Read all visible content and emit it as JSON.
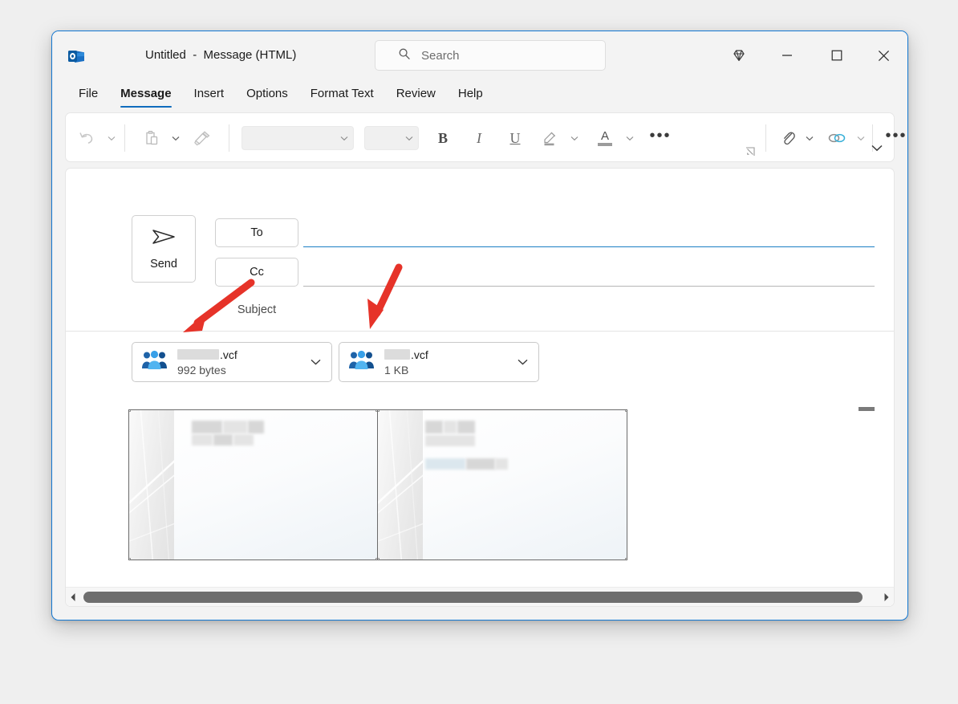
{
  "window": {
    "title": "Untitled  -  Message (HTML)",
    "app_icon": "outlook-icon",
    "border_color": "#1277d1"
  },
  "titlebar": {
    "search": {
      "placeholder": "Search",
      "icon": "search-icon"
    },
    "controls": [
      {
        "name": "diamond-icon",
        "label": ""
      },
      {
        "name": "minimize-icon",
        "label": ""
      },
      {
        "name": "maximize-icon",
        "label": ""
      },
      {
        "name": "close-icon",
        "label": ""
      }
    ]
  },
  "ribbon": {
    "tabs": [
      {
        "label": "File",
        "active": false
      },
      {
        "label": "Message",
        "active": true
      },
      {
        "label": "Insert",
        "active": false
      },
      {
        "label": "Options",
        "active": false
      },
      {
        "label": "Format Text",
        "active": false
      },
      {
        "label": "Review",
        "active": false
      },
      {
        "label": "Help",
        "active": false
      }
    ],
    "active_tab": "Message",
    "accent_color": "#0f6cbd",
    "tools": {
      "undo": "undo-icon",
      "paste": "paste-icon",
      "format_painter": "format-painter-icon",
      "font_name_value": "",
      "font_size_value": "",
      "bold": "B",
      "italic": "I",
      "underline": "U",
      "highlight": "highlighter-icon",
      "font_color": "A",
      "more_font_options": "ellipsis-icon",
      "dialog_launcher": "dialog-launcher-icon",
      "attach_file": "paperclip-icon",
      "link": "link-icon",
      "more_commands": "ellipsis-icon",
      "expand_ribbon": "chevron-down-icon"
    }
  },
  "compose": {
    "send_label": "Send",
    "send_icon": "send-plane-icon",
    "to_label": "To",
    "cc_label": "Cc",
    "subject_label": "Subject",
    "to_value": "",
    "cc_value": "",
    "subject_value": "",
    "to_focused": true,
    "to_underline_color": "#1b7fc4",
    "cc_underline_color": "#b6b6b6"
  },
  "attachments": [
    {
      "icon": "contacts-people-icon",
      "name_redacted": true,
      "name_text": "",
      "extension": ".vcf",
      "size": "992 bytes",
      "dropdown_icon": "chevron-down-icon"
    },
    {
      "icon": "contacts-people-icon",
      "name_redacted": true,
      "name_text": "",
      "extension": ".vcf",
      "size": "1 KB",
      "dropdown_icon": "chevron-down-icon"
    }
  ],
  "body": {
    "business_cards": [
      {
        "name": "electronic-business-card",
        "selected": true,
        "blurred_lines": 2
      },
      {
        "name": "electronic-business-card",
        "selected": true,
        "blurred_lines": 3
      }
    ],
    "marker": "body-dash-marker"
  },
  "scrollbar": {
    "left_arrow": "scroll-left-arrow",
    "right_arrow": "scroll-right-arrow",
    "thumb": "scroll-thumb"
  },
  "annotations": {
    "color": "#e63329",
    "arrows": [
      {
        "name": "annotation-arrow-1",
        "target": "attachment-0"
      },
      {
        "name": "annotation-arrow-2",
        "target": "attachment-1"
      }
    ]
  }
}
